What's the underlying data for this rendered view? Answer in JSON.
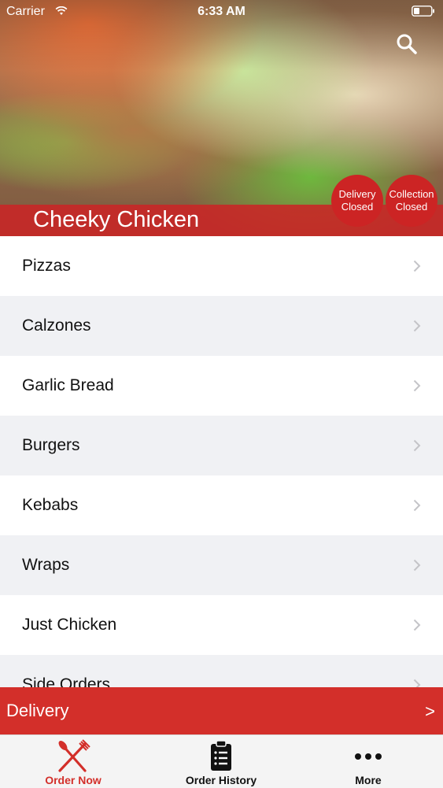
{
  "status_bar": {
    "carrier": "Carrier",
    "time": "6:33 AM"
  },
  "hero": {
    "title": "Cheeky Chicken"
  },
  "badges": {
    "delivery": {
      "line1": "Delivery",
      "line2": "Closed"
    },
    "collection": {
      "line1": "Collection",
      "line2": "Closed"
    }
  },
  "categories": [
    {
      "label": "Pizzas"
    },
    {
      "label": "Calzones"
    },
    {
      "label": "Garlic Bread"
    },
    {
      "label": "Burgers"
    },
    {
      "label": "Kebabs"
    },
    {
      "label": "Wraps"
    },
    {
      "label": "Just Chicken"
    },
    {
      "label": "Side Orders"
    }
  ],
  "delivery_bar": {
    "label": "Delivery",
    "arrow": ">"
  },
  "tabs": {
    "order_now": {
      "label": "Order Now",
      "icon": "fork-knife-icon"
    },
    "order_history": {
      "label": "Order History",
      "icon": "clipboard-list-icon"
    },
    "more": {
      "label": "More",
      "icon": "more-dots-icon"
    }
  },
  "colors": {
    "accent": "#d32f2a",
    "badge": "#cc2424",
    "row_alt": "#f0f1f4"
  }
}
